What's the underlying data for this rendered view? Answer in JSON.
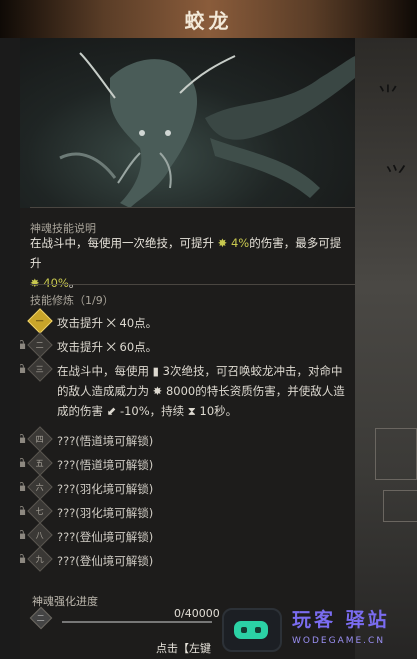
{
  "title": "蛟龙",
  "description": {
    "label": "神魂技能说明",
    "line1_pre": "在战斗中，每使用一次绝技，可提升",
    "line1_value": "4%",
    "line1_post": "的伤害，最多可提升",
    "line2_value": "40%",
    "line2_post": "。"
  },
  "skills": {
    "label": "技能修炼（1/9）",
    "items": [
      {
        "numeral": "一",
        "locked": false,
        "active": true,
        "text": "攻击提升 ⨉ 40点。"
      },
      {
        "numeral": "二",
        "locked": true,
        "active": false,
        "text": "攻击提升 ⨉ 60点。"
      },
      {
        "numeral": "三",
        "locked": true,
        "active": false,
        "line1": "在战斗中，每使用 ▮ 3次绝技，可召唤蛟龙冲击，对命中",
        "line2": "的敌人造成威力为 ✸ 8000的特长资质伤害，并使敌人造",
        "line3": "成的伤害 ⬋ -10%，持续 ⧗ 10秒。"
      },
      {
        "numeral": "四",
        "locked": true,
        "active": false,
        "text": "???(悟道境可解锁)"
      },
      {
        "numeral": "五",
        "locked": true,
        "active": false,
        "text": "???(悟道境可解锁)"
      },
      {
        "numeral": "六",
        "locked": true,
        "active": false,
        "text": "???(羽化境可解锁)"
      },
      {
        "numeral": "七",
        "locked": true,
        "active": false,
        "text": "???(羽化境可解锁)"
      },
      {
        "numeral": "八",
        "locked": true,
        "active": false,
        "text": "???(登仙境可解锁)"
      },
      {
        "numeral": "九",
        "locked": true,
        "active": false,
        "text": "???(登仙境可解锁)"
      }
    ]
  },
  "progress": {
    "label": "神魂强化进度",
    "level_numeral": "二",
    "value_text": "0/40000",
    "fraction": 0
  },
  "hint": "点击【左键",
  "watermark": {
    "text": "玩客 驿站",
    "sub": "WODEGAME.CN"
  },
  "colors": {
    "accent_gold": "#c9a52a",
    "highlight": "#c9c94f",
    "watermark_purple": "#7a6cf0",
    "watermark_icon": "#2bd1a5"
  }
}
